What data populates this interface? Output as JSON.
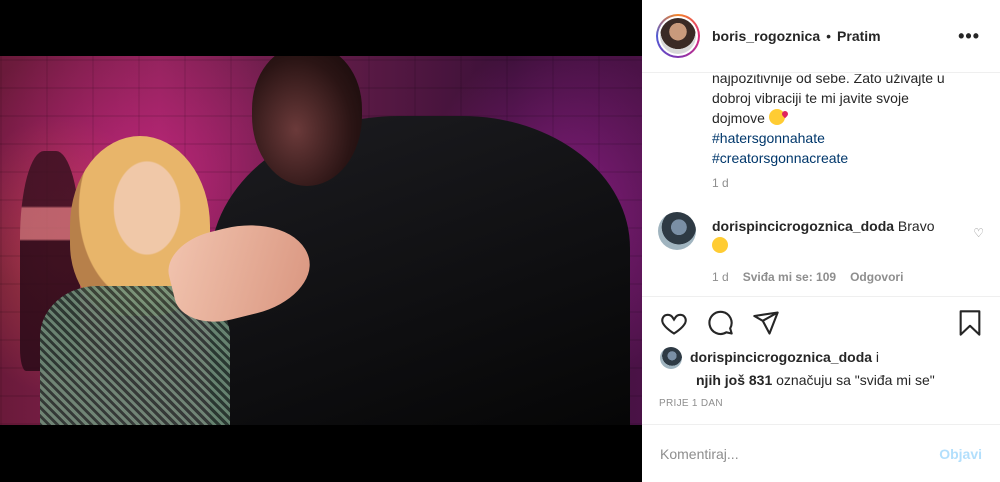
{
  "post": {
    "username": "boris_rogoznica",
    "separator": "•",
    "follow_label": "Pratim",
    "more_label": "•••"
  },
  "caption": {
    "line_partial": "najpozitivnije od sebe. Zato uživajte u",
    "line2": "dobroj vibraciji te mi javite svoje",
    "line3": "dojmove",
    "hashtags": [
      "#hatersgonnahate",
      "#creatorsgonnacreate"
    ],
    "time": "1 d"
  },
  "comment": {
    "username": "dorispincicrogoznica_doda",
    "text": "Bravo",
    "time": "1 d",
    "likes": "Sviđa mi se: 109",
    "reply": "Odgovori"
  },
  "likes": {
    "user": "dorispincicrogoznica_doda",
    "and": "i",
    "others": "njih još 831",
    "suffix": "označuju sa \"sviđa mi se\""
  },
  "timestamp": "PRIJE 1 DAN",
  "add_comment": {
    "placeholder": "Komentiraj...",
    "post_label": "Objavi"
  },
  "icons": [
    "heart-icon",
    "comment-icon",
    "share-icon",
    "bookmark-icon",
    "more-icon"
  ],
  "colors": {
    "text": "#262626",
    "secondary": "#8e8e8e",
    "hashtag": "#00376b",
    "post_button": "#b2dffc"
  }
}
